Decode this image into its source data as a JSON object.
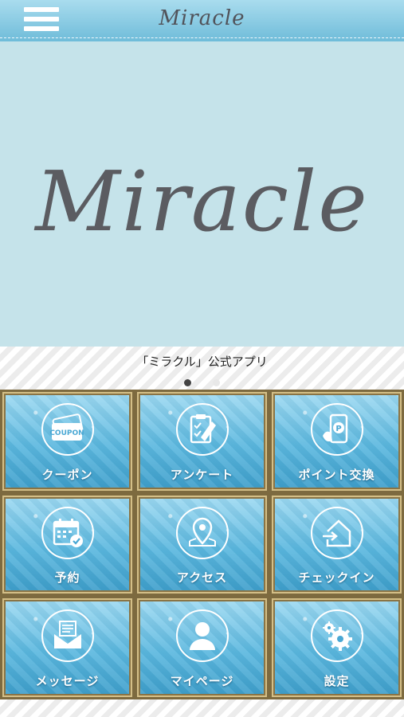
{
  "header": {
    "logo": "Miracle",
    "menu_icon": "hamburger-menu-icon"
  },
  "hero": {
    "logo": "Miracle"
  },
  "caption": {
    "text": "「ミラクル」公式アプリ",
    "page_index": 1,
    "page_count": 2
  },
  "menu": [
    {
      "label": "クーポン",
      "icon": "coupon-icon"
    },
    {
      "label": "アンケート",
      "icon": "clipboard-icon"
    },
    {
      "label": "ポイント交換",
      "icon": "point-phone-icon"
    },
    {
      "label": "予約",
      "icon": "calendar-check-icon"
    },
    {
      "label": "アクセス",
      "icon": "map-pin-icon"
    },
    {
      "label": "チェックイン",
      "icon": "check-in-icon"
    },
    {
      "label": "メッセージ",
      "icon": "message-envelope-icon"
    },
    {
      "label": "マイページ",
      "icon": "user-icon"
    },
    {
      "label": "設定",
      "icon": "gear-icon"
    }
  ]
}
